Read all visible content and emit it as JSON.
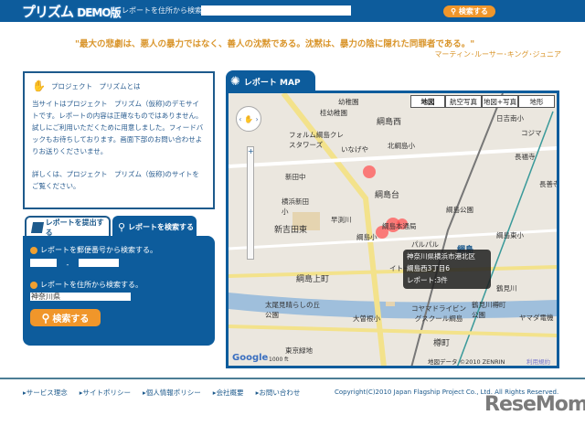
{
  "header": {
    "logo": "プリズム",
    "logo_demo": "DEMO",
    "logo_ban": "版",
    "search_label": "レポートを住所から検索する:",
    "search_value": "",
    "search_button": "検索する"
  },
  "quote": {
    "text": "\"最大の悲劇は、悪人の暴力ではなく、善人の沈黙である。沈黙は、暴力の陰に隠れた同罪者である。\"",
    "author": "マーティン･ルーサー･キング･ジュニア"
  },
  "info": {
    "title": "プロジェクト　プリズムとは",
    "p1": "当サイトはプロジェクト　プリズム（仮称)のデモサイトです。レポートの内容は正確なものではありません。試しにご利用いただくために用意しました。フィードバックもお待ちしております。画面下部のお問い合わせよりお送りくださいませ。",
    "p2": "詳しくは、プロジェクト　プリズム（仮称)のサイトをご覧ください。"
  },
  "search": {
    "tab_submit": "レポートを提出する",
    "tab_search": "レポートを検索する",
    "postal_label": "レポートを郵便番号から検索する。",
    "postal1": "",
    "postal2": "",
    "dash": "-",
    "address_label": "レポートを住所から検索する。",
    "address_value": "神奈川県",
    "button": "検索する"
  },
  "map": {
    "title": "レポート MAP",
    "types": [
      "地図",
      "航空写真",
      "地図+写真",
      "地形"
    ],
    "labels": [
      "幼稚園",
      "桂幼稚園",
      "綱島西",
      "北綱島小",
      "日吉南小",
      "コジマ",
      "長福寺",
      "フォルム綱島クレスタワーズ",
      "いなげや",
      "新田中",
      "長善寺",
      "綱島台",
      "横浜新田小",
      "早渕川",
      "新吉田東",
      "綱島公園",
      "綱島本通局",
      "綱島小",
      "パルパル",
      "綱島",
      "綱島東小",
      "綱島上町",
      "イトー",
      "鶴見川",
      "太尾見晴らしの丘公園",
      "コヤマドライビングスクール綱島",
      "大曽根小",
      "鶴見川樽町公園",
      "ヤマダ電機",
      "樽町",
      "東京緑地"
    ],
    "tooltip": [
      "神奈川県横浜市港北区",
      "綱島西3丁目6",
      "レポート:3件"
    ],
    "attribution": "地図データ ©2010 ZENRIN",
    "terms": "利用規約",
    "scale": "1000 ft",
    "powered": "Google"
  },
  "footer": {
    "links": [
      "サービス理念",
      "サイトポリシー",
      "個人情報ポリシー",
      "会社概要",
      "お問い合わせ"
    ],
    "copyright": "Copyright(C)2010 Japan Flagship Project Co., Ltd. All Rights Reserved.",
    "brand": "ReseMom."
  }
}
